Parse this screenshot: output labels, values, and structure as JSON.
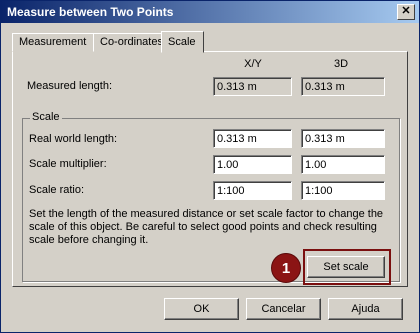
{
  "window": {
    "title": "Measure between Two Points",
    "close_glyph": "✕"
  },
  "tabs": [
    {
      "label": "Measurement",
      "active": false
    },
    {
      "label": "Co-ordinates",
      "active": false
    },
    {
      "label": "Scale",
      "active": true
    }
  ],
  "headers": {
    "xy": "X/Y",
    "threed": "3D"
  },
  "measured": {
    "label": "Measured length:",
    "xy": "0.313 m",
    "threed": "0.313 m"
  },
  "scale_group": {
    "title": "Scale",
    "real_world": {
      "label": "Real world length:",
      "xy": "0.313 m",
      "threed": "0.313 m"
    },
    "multiplier": {
      "label": "Scale multiplier:",
      "xy": "1.00",
      "threed": "1.00"
    },
    "ratio": {
      "label": "Scale ratio:",
      "xy": "1:100",
      "threed": "1:100"
    },
    "description": "Set the length of the measured distance or set scale factor to change the scale of this object. Be careful to select good points and check resulting scale before changing it.",
    "set_scale_label": "Set scale"
  },
  "annotation": {
    "marker_number": "1",
    "color": "#8b1414"
  },
  "buttons": {
    "ok": "OK",
    "cancel": "Cancelar",
    "help": "Ajuda"
  }
}
